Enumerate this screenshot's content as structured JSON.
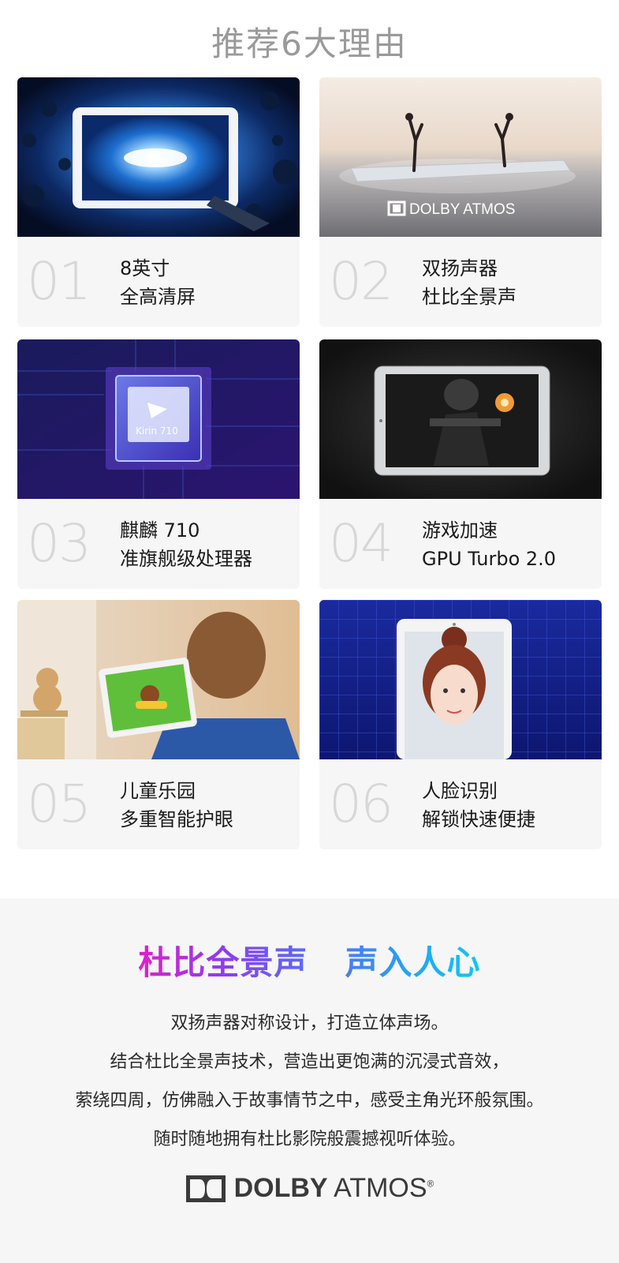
{
  "page": {
    "title": "推荐6大理由"
  },
  "cards": [
    {
      "number": "01",
      "line1": "8英寸",
      "line2": "全高清屏",
      "image": "tablet-space-explosion-image"
    },
    {
      "number": "02",
      "line1": "双扬声器",
      "line2": "杜比全景声",
      "image": "tablet-dancers-dolby-image",
      "image_logo_text": "DOLBY ATMOS"
    },
    {
      "number": "03",
      "line1": "麒麟 710",
      "line2": "准旗舰级处理器",
      "image": "kirin-chip-image",
      "image_chip_text": "Kirin 710"
    },
    {
      "number": "04",
      "line1": "游戏加速",
      "line2": "GPU Turbo 2.0",
      "image": "tablet-game-soldier-image"
    },
    {
      "number": "05",
      "line1": "儿童乐园",
      "line2": "多重智能护眼",
      "image": "child-with-tablet-image"
    },
    {
      "number": "06",
      "line1": "人脸识别",
      "line2": "解锁快速便捷",
      "image": "tablet-face-recognition-image"
    }
  ],
  "dolby_section": {
    "headline_part1": "杜比全景声",
    "headline_part2": "声入人心",
    "paragraph": [
      "双扬声器对称设计，打造立体声场。",
      "结合杜比全景声技术，营造出更饱满的沉浸式音效，",
      "萦绕四周，仿佛融入于故事情节之中，感受主角光环般氛围。",
      "随时随地拥有杜比影院般震撼视听体验。"
    ],
    "logo_bold": "DOLBY",
    "logo_light": "ATMOS",
    "logo_registered": "®"
  },
  "colors": {
    "title_gray": "#9a9a9a",
    "number_gray": "#d7d7d7",
    "card_bg": "#f6f6f6",
    "headline_gradient_1": [
      "#e020c8",
      "#5b6cf0"
    ],
    "headline_gradient_2": [
      "#4a7cf2",
      "#14c6f0"
    ]
  }
}
